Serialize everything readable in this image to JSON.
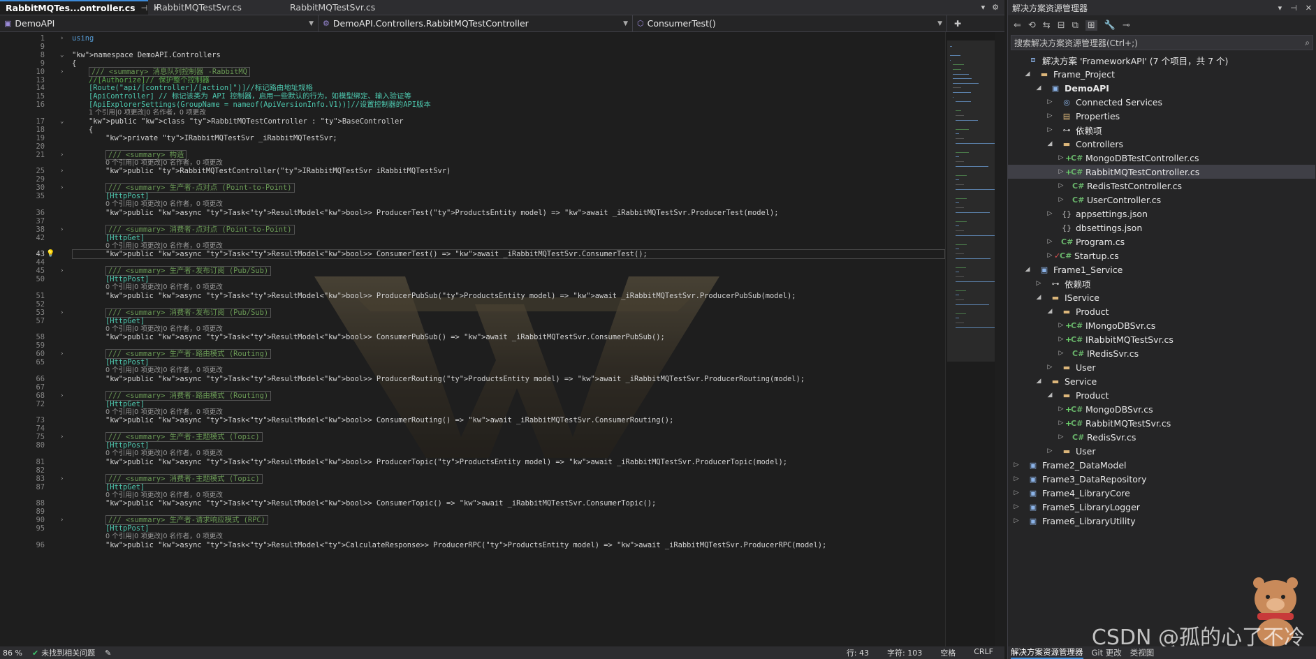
{
  "editor": {
    "tabs": [
      {
        "label": "RabbitMQTes...ontroller.cs",
        "active": true
      },
      {
        "label": "IRabbitMQTestSvr.cs",
        "active": false
      },
      {
        "label": "RabbitMQTestSvr.cs",
        "active": false
      }
    ],
    "nav": {
      "project": "DemoAPI",
      "class": "DemoAPI.Controllers.RabbitMQTestController",
      "member": "ConsumerTest()"
    }
  },
  "code_lines": [
    {
      "n": "1",
      "fold": "›",
      "text": "using",
      "kind": "using"
    },
    {
      "n": "9",
      "text": ""
    },
    {
      "n": "8",
      "fold": "⌄",
      "text": "namespace DemoAPI.Controllers",
      "kind": "ns"
    },
    {
      "n": "9",
      "text": "{",
      "kind": "brace"
    },
    {
      "n": "10",
      "fold": "›",
      "text": "/// <summary> 消息队列控制器 -RabbitMQ",
      "kind": "summary",
      "indent": 1
    },
    {
      "n": "13",
      "text": "//[Authorize]// 保护整个控制器",
      "kind": "comment",
      "indent": 1
    },
    {
      "n": "14",
      "text": "[Route(\"api/[controller]/[action]\")]//标记路由地址规格",
      "kind": "attr",
      "indent": 1
    },
    {
      "n": "15",
      "text": "[ApiController] // 标记该类为 API 控制器，启用一些默认的行为，如模型绑定、输入验证等",
      "kind": "attr",
      "indent": 1
    },
    {
      "n": "16",
      "text": "[ApiExplorerSettings(GroupName = nameof(ApiVersionInfo.V1))]//设置控制器的API版本",
      "kind": "attr",
      "indent": 1
    },
    {
      "n": "",
      "text": "1 个引用|0 项更改|0 名作者，0 项更改",
      "kind": "lens",
      "indent": 1
    },
    {
      "n": "17",
      "fold": "⌄",
      "text": "public class RabbitMQTestController : BaseController",
      "kind": "class",
      "indent": 1
    },
    {
      "n": "18",
      "text": "{",
      "kind": "brace",
      "indent": 1
    },
    {
      "n": "19",
      "text": "private IRabbitMQTestSvr _iRabbitMQTestSvr;",
      "kind": "field",
      "indent": 2
    },
    {
      "n": "20",
      "text": ""
    },
    {
      "n": "21",
      "fold": "›",
      "text": "/// <summary> 构造",
      "kind": "summary",
      "indent": 2
    },
    {
      "n": "",
      "text": "0 个引用|0 项更改|0 名作者，0 项更改",
      "kind": "lens",
      "indent": 2
    },
    {
      "n": "25",
      "fold": "›",
      "text": "public RabbitMQTestController(IRabbitMQTestSvr iRabbitMQTestSvr)",
      "kind": "ctor",
      "indent": 2
    },
    {
      "n": "29",
      "text": ""
    },
    {
      "n": "30",
      "fold": "›",
      "text": "/// <summary> 生产者-点对点 (Point-to-Point)",
      "kind": "summary",
      "indent": 2
    },
    {
      "n": "35",
      "text": "[HttpPost]",
      "kind": "attr",
      "indent": 2
    },
    {
      "n": "",
      "text": "0 个引用|0 项更改|0 名作者，0 项更改",
      "kind": "lens",
      "indent": 2
    },
    {
      "n": "36",
      "text": "public async Task<ResultModel<bool>> ProducerTest(ProductsEntity model) => await _iRabbitMQTestSvr.ProducerTest(model);",
      "kind": "method",
      "indent": 2
    },
    {
      "n": "37",
      "text": ""
    },
    {
      "n": "38",
      "fold": "›",
      "text": "/// <summary> 消费者-点对点 (Point-to-Point)",
      "kind": "summary",
      "indent": 2
    },
    {
      "n": "42",
      "text": "[HttpGet]",
      "kind": "attr",
      "indent": 2
    },
    {
      "n": "",
      "text": "0 个引用|0 项更改|0 名作者，0 项更改",
      "kind": "lens",
      "indent": 2
    },
    {
      "n": "43",
      "text": "public async Task<ResultModel<bool>> ConsumerTest() => await _iRabbitMQTestSvr.ConsumerTest();",
      "kind": "method",
      "indent": 2,
      "current": true
    },
    {
      "n": "44",
      "text": ""
    },
    {
      "n": "45",
      "fold": "›",
      "text": "/// <summary> 生产者-发布订阅 (Pub/Sub)",
      "kind": "summary",
      "indent": 2
    },
    {
      "n": "50",
      "text": "[HttpPost]",
      "kind": "attr",
      "indent": 2
    },
    {
      "n": "",
      "text": "0 个引用|0 项更改|0 名作者，0 项更改",
      "kind": "lens",
      "indent": 2
    },
    {
      "n": "51",
      "text": "public async Task<ResultModel<bool>> ProducerPubSub(ProductsEntity model) => await _iRabbitMQTestSvr.ProducerPubSub(model);",
      "kind": "method",
      "indent": 2
    },
    {
      "n": "52",
      "text": ""
    },
    {
      "n": "53",
      "fold": "›",
      "text": "/// <summary> 消费者-发布订阅 (Pub/Sub)",
      "kind": "summary",
      "indent": 2
    },
    {
      "n": "57",
      "text": "[HttpGet]",
      "kind": "attr",
      "indent": 2
    },
    {
      "n": "",
      "text": "0 个引用|0 项更改|0 名作者，0 项更改",
      "kind": "lens",
      "indent": 2
    },
    {
      "n": "58",
      "text": "public async Task<ResultModel<bool>> ConsumerPubSub() => await _iRabbitMQTestSvr.ConsumerPubSub();",
      "kind": "method",
      "indent": 2
    },
    {
      "n": "59",
      "text": ""
    },
    {
      "n": "60",
      "fold": "›",
      "text": "/// <summary> 生产者-路由模式 (Routing)",
      "kind": "summary",
      "indent": 2
    },
    {
      "n": "65",
      "text": "[HttpPost]",
      "kind": "attr",
      "indent": 2
    },
    {
      "n": "",
      "text": "0 个引用|0 项更改|0 名作者，0 项更改",
      "kind": "lens",
      "indent": 2
    },
    {
      "n": "66",
      "text": "public async Task<ResultModel<bool>> ProducerRouting(ProductsEntity model) => await _iRabbitMQTestSvr.ProducerRouting(model);",
      "kind": "method",
      "indent": 2
    },
    {
      "n": "67",
      "text": ""
    },
    {
      "n": "68",
      "fold": "›",
      "text": "/// <summary> 消费者-路由模式 (Routing)",
      "kind": "summary",
      "indent": 2
    },
    {
      "n": "72",
      "text": "[HttpGet]",
      "kind": "attr",
      "indent": 2
    },
    {
      "n": "",
      "text": "0 个引用|0 项更改|0 名作者，0 项更改",
      "kind": "lens",
      "indent": 2
    },
    {
      "n": "73",
      "text": "public async Task<ResultModel<bool>> ConsumerRouting() => await _iRabbitMQTestSvr.ConsumerRouting();",
      "kind": "method",
      "indent": 2
    },
    {
      "n": "74",
      "text": ""
    },
    {
      "n": "75",
      "fold": "›",
      "text": "/// <summary> 生产者-主题模式 (Topic)",
      "kind": "summary",
      "indent": 2
    },
    {
      "n": "80",
      "text": "[HttpPost]",
      "kind": "attr",
      "indent": 2
    },
    {
      "n": "",
      "text": "0 个引用|0 项更改|0 名作者，0 项更改",
      "kind": "lens",
      "indent": 2
    },
    {
      "n": "81",
      "text": "public async Task<ResultModel<bool>> ProducerTopic(ProductsEntity model) => await _iRabbitMQTestSvr.ProducerTopic(model);",
      "kind": "method",
      "indent": 2
    },
    {
      "n": "82",
      "text": ""
    },
    {
      "n": "83",
      "fold": "›",
      "text": "/// <summary> 消费者-主题模式 (Topic)",
      "kind": "summary",
      "indent": 2
    },
    {
      "n": "87",
      "text": "[HttpGet]",
      "kind": "attr",
      "indent": 2
    },
    {
      "n": "",
      "text": "0 个引用|0 项更改|0 名作者，0 项更改",
      "kind": "lens",
      "indent": 2
    },
    {
      "n": "88",
      "text": "public async Task<ResultModel<bool>> ConsumerTopic() => await _iRabbitMQTestSvr.ConsumerTopic();",
      "kind": "method",
      "indent": 2
    },
    {
      "n": "89",
      "text": ""
    },
    {
      "n": "90",
      "fold": "›",
      "text": "/// <summary> 生产者-请求响应模式 (RPC)",
      "kind": "summary",
      "indent": 2
    },
    {
      "n": "95",
      "text": "[HttpPost]",
      "kind": "attr",
      "indent": 2
    },
    {
      "n": "",
      "text": "0 个引用|0 项更改|0 名作者，0 项更改",
      "kind": "lens",
      "indent": 2
    },
    {
      "n": "96",
      "text": "public async Task<ResultModel<CalculateResponse>> ProducerRPC(ProductsEntity model) => await _iRabbitMQTestSvr.ProducerRPC(model);",
      "kind": "method",
      "indent": 2
    }
  ],
  "status": {
    "zoom": "86 %",
    "issues": "未找到相关问题",
    "line": "行: 43",
    "char": "字符: 103",
    "spaces": "空格",
    "eol": "CRLF"
  },
  "solution_explorer": {
    "title": "解决方案资源管理器",
    "search_placeholder": "搜索解决方案资源管理器(Ctrl+;)",
    "nodes": [
      {
        "depth": 0,
        "arrow": "",
        "icon": "solution",
        "label": "解决方案 'FrameworkAPI' (7 个项目，共 7 个)"
      },
      {
        "depth": 1,
        "arrow": "◢",
        "icon": "folder",
        "label": "Frame_Project"
      },
      {
        "depth": 2,
        "arrow": "◢",
        "icon": "project",
        "label": "DemoAPI",
        "bold": true
      },
      {
        "depth": 3,
        "arrow": "▷",
        "icon": "connected",
        "label": "Connected Services"
      },
      {
        "depth": 3,
        "arrow": "▷",
        "icon": "properties",
        "label": "Properties"
      },
      {
        "depth": 3,
        "arrow": "▷",
        "icon": "deps",
        "label": "依赖项"
      },
      {
        "depth": 3,
        "arrow": "◢",
        "icon": "folder",
        "label": "Controllers"
      },
      {
        "depth": 4,
        "arrow": "▷",
        "icon": "cs",
        "mark": "+",
        "label": "MongoDBTestController.cs"
      },
      {
        "depth": 4,
        "arrow": "▷",
        "icon": "cs",
        "mark": "+",
        "label": "RabbitMQTestController.cs",
        "selected": true
      },
      {
        "depth": 4,
        "arrow": "▷",
        "icon": "cs",
        "label": "RedisTestController.cs"
      },
      {
        "depth": 4,
        "arrow": "▷",
        "icon": "cs",
        "label": "UserController.cs"
      },
      {
        "depth": 3,
        "arrow": "▷",
        "icon": "json",
        "label": "appsettings.json"
      },
      {
        "depth": 3,
        "arrow": "",
        "icon": "json",
        "label": "dbsettings.json"
      },
      {
        "depth": 3,
        "arrow": "▷",
        "icon": "cs",
        "label": "Program.cs"
      },
      {
        "depth": 3,
        "arrow": "▷",
        "icon": "cs",
        "mark": "✓",
        "label": "Startup.cs"
      },
      {
        "depth": 1,
        "arrow": "◢",
        "icon": "project",
        "label": "Frame1_Service"
      },
      {
        "depth": 2,
        "arrow": "▷",
        "icon": "deps",
        "label": "依赖项"
      },
      {
        "depth": 2,
        "arrow": "◢",
        "icon": "folder",
        "label": "IService"
      },
      {
        "depth": 3,
        "arrow": "◢",
        "icon": "folder",
        "label": "Product"
      },
      {
        "depth": 4,
        "arrow": "▷",
        "icon": "cs",
        "mark": "+",
        "label": "IMongoDBSvr.cs"
      },
      {
        "depth": 4,
        "arrow": "▷",
        "icon": "cs",
        "mark": "+",
        "label": "IRabbitMQTestSvr.cs"
      },
      {
        "depth": 4,
        "arrow": "▷",
        "icon": "cs",
        "label": "IRedisSvr.cs"
      },
      {
        "depth": 3,
        "arrow": "▷",
        "icon": "folder",
        "label": "User"
      },
      {
        "depth": 2,
        "arrow": "◢",
        "icon": "folder",
        "label": "Service"
      },
      {
        "depth": 3,
        "arrow": "◢",
        "icon": "folder",
        "label": "Product"
      },
      {
        "depth": 4,
        "arrow": "▷",
        "icon": "cs",
        "mark": "+",
        "label": "MongoDBSvr.cs"
      },
      {
        "depth": 4,
        "arrow": "▷",
        "icon": "cs",
        "mark": "+",
        "label": "RabbitMQTestSvr.cs"
      },
      {
        "depth": 4,
        "arrow": "▷",
        "icon": "cs",
        "label": "RedisSvr.cs"
      },
      {
        "depth": 3,
        "arrow": "▷",
        "icon": "folder",
        "label": "User"
      },
      {
        "depth": 0,
        "arrow": "▷",
        "icon": "project",
        "label": "Frame2_DataModel"
      },
      {
        "depth": 0,
        "arrow": "▷",
        "icon": "project",
        "label": "Frame3_DataRepository"
      },
      {
        "depth": 0,
        "arrow": "▷",
        "icon": "project",
        "label": "Frame4_LibraryCore"
      },
      {
        "depth": 0,
        "arrow": "▷",
        "icon": "project",
        "label": "Frame5_LibraryLogger"
      },
      {
        "depth": 0,
        "arrow": "▷",
        "icon": "project",
        "label": "Frame6_LibraryUtility"
      }
    ],
    "bottom_tabs": [
      "解决方案资源管理器",
      "Git 更改",
      "类视图"
    ]
  },
  "watermark": "CSDN @孤的心了不冷",
  "colors": {
    "accent": "#3c8ad8",
    "keyword": "#569cd6",
    "type": "#4ec9b0",
    "string": "#d69d85",
    "comment": "#57a64a"
  }
}
